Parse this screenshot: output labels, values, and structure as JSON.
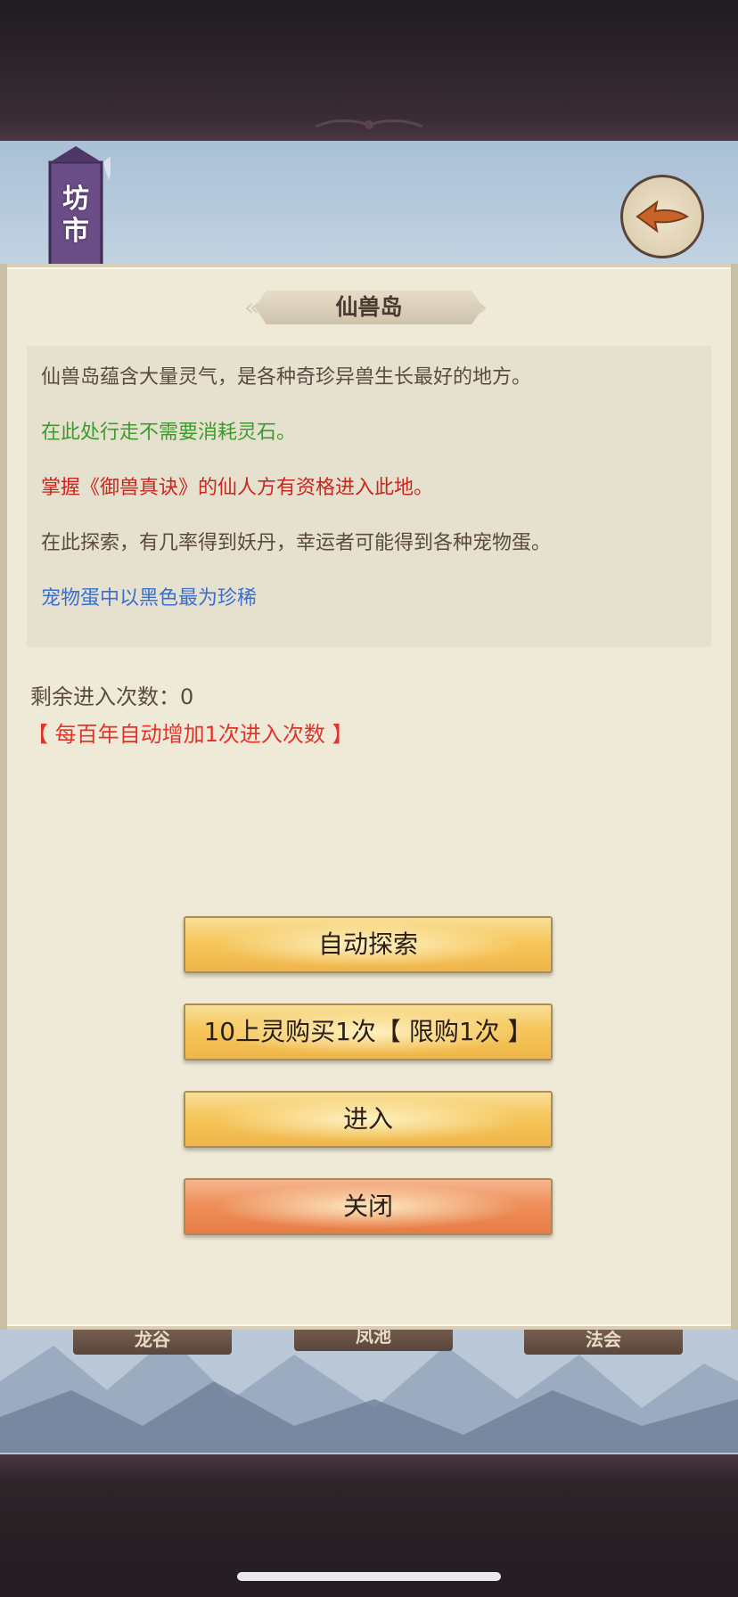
{
  "header": {
    "banner_label": "坊市",
    "back_icon": "back-arrow-icon"
  },
  "background_tabs": [
    "龙谷",
    "凤池",
    "法会"
  ],
  "dialog": {
    "title": "仙兽岛",
    "description": [
      {
        "text": "仙兽岛蕴含大量灵气，是各种奇珍异兽生长最好的地方。",
        "color": "#5b4a40"
      },
      {
        "text": "在此处行走不需要消耗灵石。",
        "color": "#3f9a2e"
      },
      {
        "text": "掌握《御兽真诀》的仙人方有资格进入此地。",
        "color": "#c8261e"
      },
      {
        "text": "在此探索，有几率得到妖丹，幸运者可能得到各种宠物蛋。",
        "color": "#5b4a40"
      },
      {
        "text": "宠物蛋中以黑色最为珍稀",
        "color": "#3a6fd0"
      }
    ],
    "remaining_entries": "剩余进入次数：0",
    "auto_increase_note": "【 每百年自动增加1次进入次数 】",
    "buttons": {
      "auto_explore": "自动探索",
      "buy": "10上灵购买1次【 限购1次 】",
      "enter": "进入",
      "close": "关闭"
    }
  },
  "colors": {
    "panel_bg": "#efead8",
    "button_gold": "#f6c65a",
    "button_orange": "#ee8f5a"
  }
}
